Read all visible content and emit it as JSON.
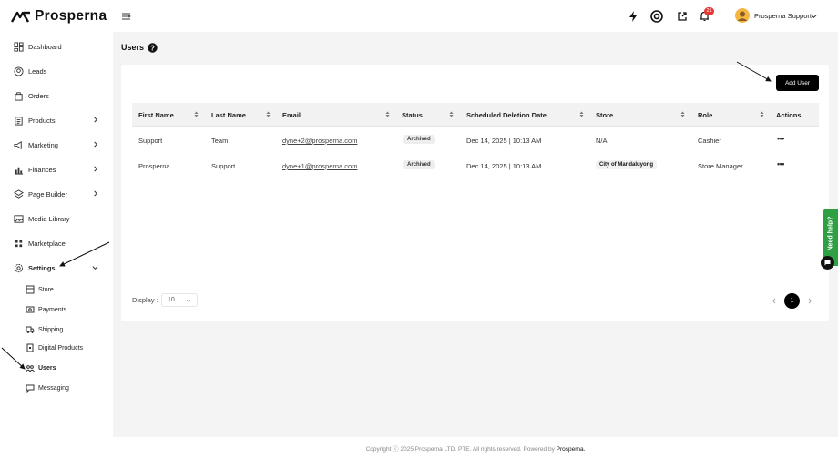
{
  "brand": {
    "name": "Prosperna"
  },
  "sidebar": {
    "items": [
      {
        "label": "Dashboard"
      },
      {
        "label": "Leads"
      },
      {
        "label": "Orders"
      },
      {
        "label": "Products"
      },
      {
        "label": "Marketing"
      },
      {
        "label": "Finances"
      },
      {
        "label": "Page Builder"
      },
      {
        "label": "Media Library"
      },
      {
        "label": "Marketplace"
      },
      {
        "label": "Settings"
      }
    ],
    "settings_sub": [
      {
        "label": "Store"
      },
      {
        "label": "Payments"
      },
      {
        "label": "Shipping"
      },
      {
        "label": "Digital Products"
      },
      {
        "label": "Users"
      },
      {
        "label": "Messaging"
      }
    ]
  },
  "header": {
    "notification_count": "21",
    "user_name": "Prosperna Support"
  },
  "page": {
    "title": "Users",
    "add_button": "Add User"
  },
  "table": {
    "headers": [
      "First Name",
      "Last Name",
      "Email",
      "Status",
      "Scheduled Deletion Date",
      "Store",
      "Role",
      "Actions"
    ],
    "rows": [
      {
        "first": "Support",
        "last": "Team",
        "email": "dyne+2@prosperna.com",
        "status": "Archived",
        "date": "Dec 14, 2025 | 10:13 AM",
        "store": "N/A",
        "role": "Cashier"
      },
      {
        "first": "Prosperna",
        "last": "Support",
        "email": "dyne+1@prosperna.com",
        "status": "Archived",
        "date": "Dec 14, 2025 | 10:13 AM",
        "store": "City of Mandaluyong",
        "role": "Store Manager"
      }
    ]
  },
  "pagination": {
    "display_label": "Display :",
    "per_page": "10",
    "current_page": "1"
  },
  "help": {
    "label": "Need help?"
  },
  "footer": {
    "text": "Copyright ⓒ 2025 Prosperna LTD. PTE. All rights reserved. Powered by ",
    "brand": "Prosperna."
  },
  "colors": {
    "accent": "#000000",
    "help_green": "#2ea043",
    "notification_red": "#e53935"
  }
}
